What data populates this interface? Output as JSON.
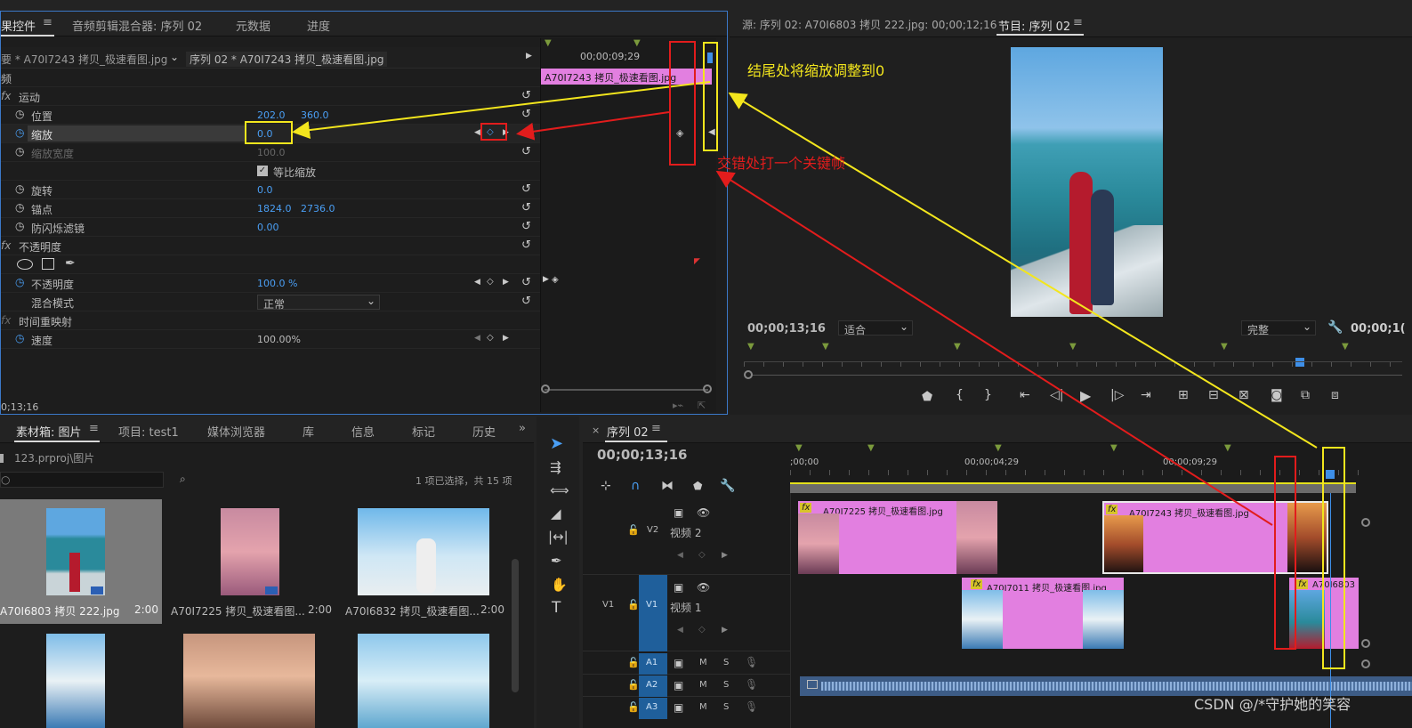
{
  "effect_controls": {
    "tabs": [
      "果控件",
      "音频剪辑混合器: 序列 02",
      "元数据",
      "进度"
    ],
    "source_label": "要 * A70I7243 拷贝_极速看图.jpg",
    "sequence_label": "序列 02 * A70I7243 拷贝_极速看图.jpg",
    "timeline_time": "00;00;09;29",
    "clip_label": "A70I7243 拷贝_极速看图.jpg",
    "section_video": "频",
    "motion": "运动",
    "position_label": "位置",
    "position_x": "202.0",
    "position_y": "360.0",
    "scale_label": "缩放",
    "scale_value": "0.0",
    "scale_width_label": "缩放宽度",
    "scale_width_value": "100.0",
    "uniform_scale": "等比缩放",
    "rotation_label": "旋转",
    "rotation_value": "0.0",
    "anchor_label": "锚点",
    "anchor_x": "1824.0",
    "anchor_y": "2736.0",
    "antiflicker_label": "防闪烁滤镜",
    "antiflicker_value": "0.00",
    "opacity_section": "不透明度",
    "opacity_label": "不透明度",
    "opacity_value": "100.0 %",
    "blend_label": "混合模式",
    "blend_value": "正常",
    "time_remap": "时间重映射",
    "speed_label": "速度",
    "speed_value": "100.00%",
    "bottom_time": "0;13;16"
  },
  "source_monitor": {
    "title": "源: 序列 02: A70I6803 拷贝 222.jpg: 00;00;12;16"
  },
  "program_monitor": {
    "title": "节目: 序列 02",
    "timecode": "00;00;13;16",
    "fit": "适合",
    "quality": "完整",
    "timecode_right": "00;00;1("
  },
  "annotations": {
    "yellow_text": "结尾处将缩放调整到0",
    "red_text": "交错处打一个关键帧"
  },
  "bin": {
    "tabs": [
      "素材箱: 图片",
      "项目: test1",
      "媒体浏览器",
      "库",
      "信息",
      "标记",
      "历史"
    ],
    "path": "123.prproj\\图片",
    "selection_info": "1 项已选择，共 15 项",
    "items": [
      {
        "name": "A70I6803 拷贝 222.jpg",
        "duration": "2:00"
      },
      {
        "name": "A70I7225 拷贝_极速看图...",
        "duration": "2:00"
      },
      {
        "name": "A70I6832 拷贝_极速看图...",
        "duration": "2:00"
      }
    ]
  },
  "timeline": {
    "tab": "序列 02",
    "timecode": "00;00;13;16",
    "ruler": [
      ";00;00",
      "00;00;04;29",
      "00;00;09;29"
    ],
    "tracks": {
      "v2": "V2",
      "v2_name": "视频 2",
      "v1": "V1",
      "v1_name": "视频 1",
      "a1": "A1",
      "a2": "A2",
      "a3": "A3",
      "m": "M",
      "s": "S"
    },
    "clips": {
      "v2_a": "A70I7225 拷贝_极速看图.jpg",
      "v2_b": "A70I7243 拷贝_极速看图.jpg",
      "v1_a": "A70I7011 拷贝_极速看图.jpg",
      "v1_b": "A70I6803"
    },
    "fx": "fx"
  },
  "watermark": "CSDN @/*守护她的笑容"
}
